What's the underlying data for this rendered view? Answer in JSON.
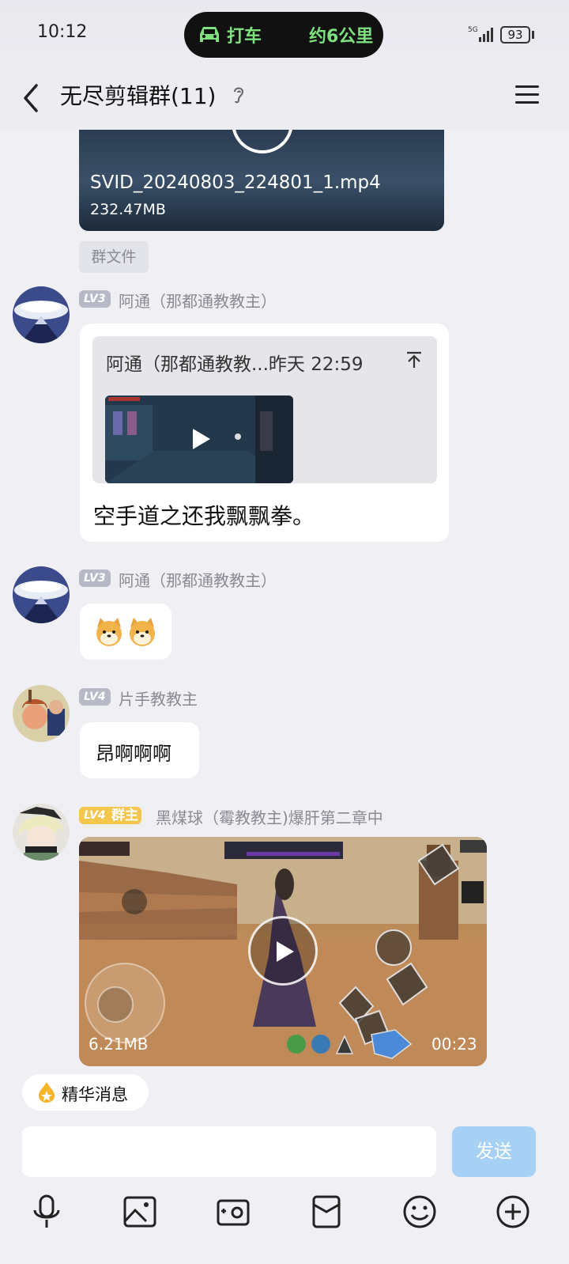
{
  "status_bar": {
    "time": "10:12",
    "taxi_label": "打车",
    "taxi_distance": "约6公里",
    "battery": "93"
  },
  "header": {
    "title": "无尽剪辑群(11)"
  },
  "messages": [
    {
      "type": "file",
      "file_name": "SVID_20240803_224801_1.mp4",
      "file_size": "232.47MB",
      "tag": "群文件"
    },
    {
      "type": "quote",
      "level": "LV3",
      "sender": "阿通（那都通教教主）",
      "quote_header": "阿通（那都通教教...昨天 22:59",
      "text": "空手道之还我飘飘拳。"
    },
    {
      "type": "emoji",
      "level": "LV3",
      "sender": "阿通（那都通教教主）"
    },
    {
      "type": "text",
      "level": "LV4",
      "sender": "片手教教主",
      "text": "昂啊啊啊"
    },
    {
      "type": "video",
      "level": "LV4",
      "role": "群主",
      "sender": "黑煤球（霉教教主)爆肝第二章中",
      "video_size": "6.21MB",
      "duration": "00:23"
    }
  ],
  "bottom": {
    "essence_label": "精华消息",
    "input_placeholder": "",
    "send_label": "发送",
    "toolbar_icons": [
      "microphone-icon",
      "image-icon",
      "camera-icon",
      "red-packet-icon",
      "emoji-icon",
      "plus-icon"
    ]
  },
  "colors": {
    "background": "#f0f0f4",
    "send_button": "#a7d0f5",
    "owner_badge": "#f5c64d",
    "level_badge": "#b7bac6"
  }
}
